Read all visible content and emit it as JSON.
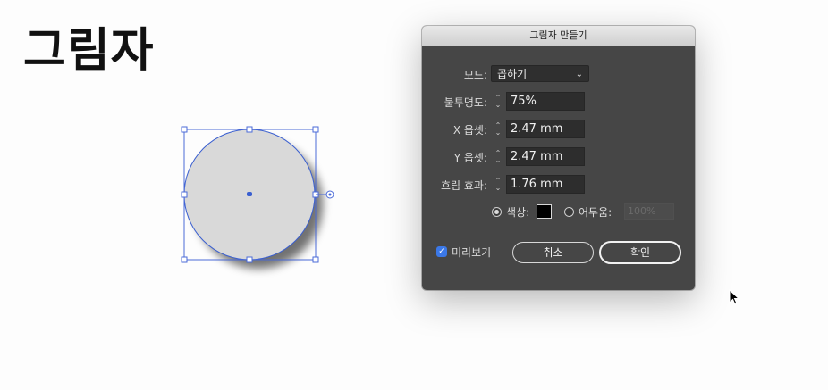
{
  "heading": "그림자",
  "dialog": {
    "title": "그림자 만들기",
    "mode": {
      "label": "모드:",
      "value": "곱하기"
    },
    "opacity": {
      "label": "불투명도:",
      "value": "75%"
    },
    "x_offset": {
      "label": "X 옵셋:",
      "value": "2.47 mm"
    },
    "y_offset": {
      "label": "Y 옵셋:",
      "value": "2.47 mm"
    },
    "blur": {
      "label": "흐림 효과:",
      "value": "1.76 mm"
    },
    "color_option": {
      "label": "색상:",
      "swatch": "#000000",
      "selected": true
    },
    "darkness_option": {
      "label": "어두움:",
      "value": "100%",
      "selected": false
    },
    "preview": {
      "label": "미리보기",
      "checked": true
    },
    "cancel_label": "취소",
    "ok_label": "확인"
  },
  "colors": {
    "selection_blue": "#3a5fd0",
    "circle_fill": "#d9d9d9",
    "dialog_bg": "#464646"
  }
}
